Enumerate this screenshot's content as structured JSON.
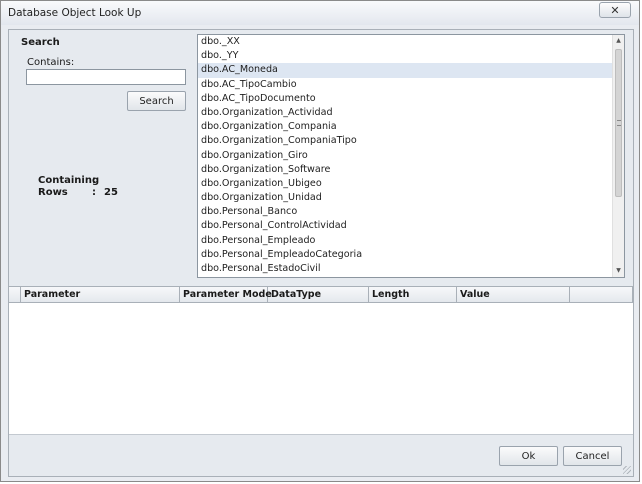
{
  "window": {
    "title": "Database Object Look Up"
  },
  "search": {
    "heading": "Search",
    "contains_label": "Contains:",
    "contains_value": "",
    "button_label": "Search"
  },
  "stats": {
    "containing_label": "Containing",
    "containing_value": "",
    "rows_label": "Rows",
    "rows_value": "25",
    "colon": ":"
  },
  "objects": {
    "selected_index": 2,
    "items": [
      "dbo._XX",
      "dbo._YY",
      "dbo.AC_Moneda",
      "dbo.AC_TipoCambio",
      "dbo.AC_TipoDocumento",
      "dbo.Organization_Actividad",
      "dbo.Organization_Compania",
      "dbo.Organization_CompaniaTipo",
      "dbo.Organization_Giro",
      "dbo.Organization_Software",
      "dbo.Organization_Ubigeo",
      "dbo.Organization_Unidad",
      "dbo.Personal_Banco",
      "dbo.Personal_ControlActividad",
      "dbo.Personal_Empleado",
      "dbo.Personal_EmpleadoCategoria",
      "dbo.Personal_EstadoCivil"
    ]
  },
  "parameters_grid": {
    "columns": [
      "",
      "Parameter",
      "Parameter Mode",
      "DataType",
      "Length",
      "Value",
      ""
    ],
    "rows": []
  },
  "footer": {
    "ok_label": "Ok",
    "cancel_label": "Cancel"
  },
  "icons": {
    "close": "close-icon"
  }
}
